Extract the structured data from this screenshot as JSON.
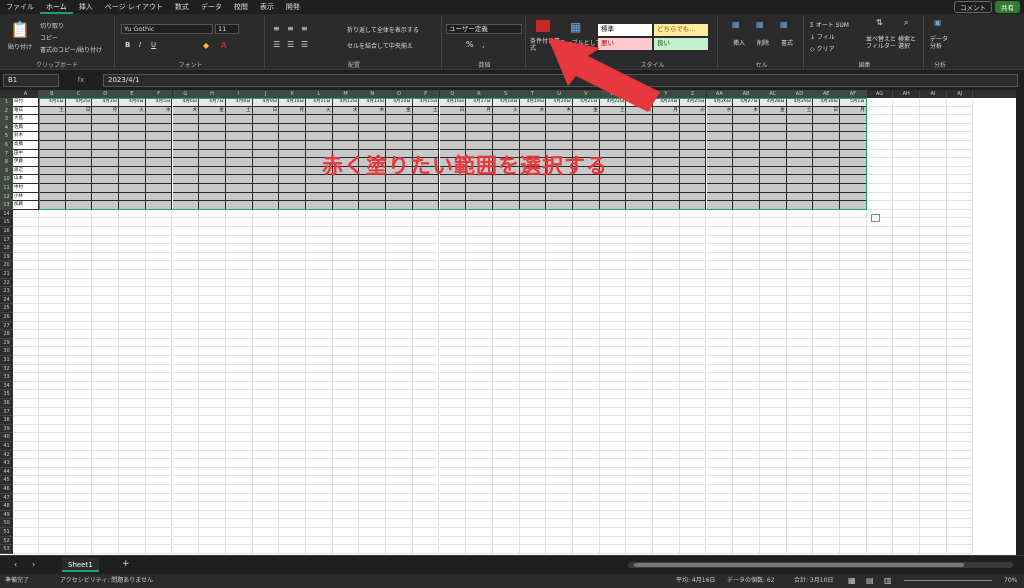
{
  "menu_tabs": [
    "ファイル",
    "ホーム",
    "挿入",
    "ページ レイアウト",
    "数式",
    "データ",
    "校閲",
    "表示",
    "開発"
  ],
  "active_tab_index": 1,
  "top_right": {
    "comment": "コメント",
    "share": "共有"
  },
  "ribbon": {
    "clipboard": {
      "paste": "貼り付け",
      "cut": "切り取り",
      "copy": "コピー",
      "format_painter": "書式のコピー/貼り付け",
      "label": "クリップボード"
    },
    "font": {
      "name": "Yu Gothic",
      "size": "11",
      "label": "フォント"
    },
    "alignment": {
      "wrap": "折り返して全体を表示する",
      "merge": "セルを結合して中央揃え",
      "label": "配置"
    },
    "number": {
      "format": "ユーザー定義",
      "label": "数値"
    },
    "styles": {
      "conditional": "条件付き書式",
      "table": "テーブルとして書式設定",
      "label": "スタイル",
      "cells": [
        "標準",
        "どちらでも...",
        "悪い",
        "良い"
      ]
    },
    "cells": {
      "insert": "挿入",
      "delete": "削除",
      "format": "書式",
      "label": "セル"
    },
    "editing": {
      "autosum": "オート SUM",
      "fill": "フィル",
      "clear": "クリア",
      "sort": "並べ替えと フィルター",
      "find": "検索と 選択",
      "label": "編集"
    },
    "analysis": {
      "analyze": "データ 分析",
      "label": "分析"
    }
  },
  "formula_bar": {
    "name_box": "B1",
    "fx": "fx",
    "value": "2023/4/1"
  },
  "grid": {
    "columns": [
      "A",
      "B",
      "C",
      "D",
      "E",
      "F",
      "G",
      "H",
      "I",
      "J",
      "K",
      "L",
      "M",
      "N",
      "O",
      "P",
      "Q",
      "R",
      "S",
      "T",
      "U",
      "V",
      "W",
      "X",
      "Y",
      "Z",
      "AA",
      "AB",
      "AC",
      "AD",
      "AE",
      "AF",
      "AG",
      "AH",
      "AI",
      "AJ"
    ],
    "row1_label": "日付",
    "row2_label": "曜日",
    "dates": [
      "4月1日",
      "4月2日",
      "4月3日",
      "4月4日",
      "4月5日",
      "4月6日",
      "4月7日",
      "4月8日",
      "4月9日",
      "4月10日",
      "4月11日",
      "4月12日",
      "4月13日",
      "4月14日",
      "4月15日",
      "4月16日",
      "4月17日",
      "4月18日",
      "4月19日",
      "4月20日",
      "4月21日",
      "4月22日",
      "4月23日",
      "4月24日",
      "4月25日",
      "4月26日",
      "4月27日",
      "4月28日",
      "4月29日",
      "4月30日",
      "5月1日"
    ],
    "weekdays": [
      "土",
      "日",
      "月",
      "火",
      "水",
      "木",
      "金",
      "土",
      "日",
      "月",
      "火",
      "水",
      "木",
      "金",
      "土",
      "日",
      "月",
      "火",
      "水",
      "木",
      "金",
      "土",
      "日",
      "月",
      "火",
      "水",
      "木",
      "金",
      "土",
      "日",
      "月"
    ],
    "names": [
      "大島",
      "佐藤",
      "鈴木",
      "高橋",
      "田中",
      "伊藤",
      "渡辺",
      "山本",
      "中村",
      "小林",
      "加藤"
    ]
  },
  "annotation": "赤く塗りたい範囲を選択する",
  "sheet_tab": "Sheet1",
  "status": {
    "ready": "準備完了",
    "accessibility": "アクセシビリティ: 問題ありません",
    "average": "平均: 4月16日",
    "count": "データの個数: 62",
    "sum": "合計: 3月10日",
    "zoom": "70%"
  }
}
